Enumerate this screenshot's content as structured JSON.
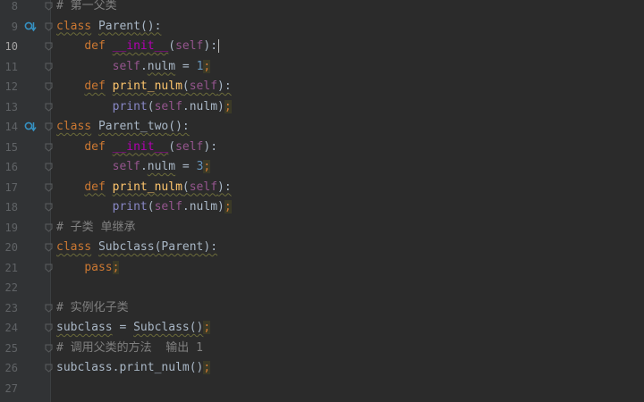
{
  "editor": {
    "lines": [
      {
        "n": "8",
        "segments": [
          {
            "t": "# 第一父类",
            "c": "cmt"
          }
        ]
      },
      {
        "n": "9",
        "marker": true,
        "segments": [
          {
            "t": "class",
            "c": "kw wavy"
          },
          {
            "t": " ",
            "c": ""
          },
          {
            "t": "Parent",
            "c": "wavy"
          },
          {
            "t": "():",
            "c": "wavy"
          }
        ]
      },
      {
        "n": "10",
        "current": true,
        "segments": [
          {
            "t": "    ",
            "c": ""
          },
          {
            "t": "def",
            "c": "kw"
          },
          {
            "t": " ",
            "c": ""
          },
          {
            "t": "__init__",
            "c": "magic wavy"
          },
          {
            "t": "(",
            "c": ""
          },
          {
            "t": "self",
            "c": "self"
          },
          {
            "t": "):",
            "c": ""
          }
        ]
      },
      {
        "n": "11",
        "segments": [
          {
            "t": "        ",
            "c": ""
          },
          {
            "t": "self",
            "c": "self"
          },
          {
            "t": ".",
            "c": ""
          },
          {
            "t": "nulm",
            "c": "wavy"
          },
          {
            "t": " = ",
            "c": ""
          },
          {
            "t": "1",
            "c": "num"
          },
          {
            "t": ";",
            "c": "semi"
          }
        ]
      },
      {
        "n": "12",
        "segments": [
          {
            "t": "    ",
            "c": ""
          },
          {
            "t": "def",
            "c": "kw wavy"
          },
          {
            "t": " ",
            "c": ""
          },
          {
            "t": "print_nulm",
            "c": "fn wavy"
          },
          {
            "t": "(",
            "c": "wavy"
          },
          {
            "t": "self",
            "c": "self wavy"
          },
          {
            "t": "):",
            "c": "wavy"
          }
        ]
      },
      {
        "n": "13",
        "segments": [
          {
            "t": "        ",
            "c": ""
          },
          {
            "t": "print",
            "c": "builtin"
          },
          {
            "t": "(",
            "c": ""
          },
          {
            "t": "self",
            "c": "self"
          },
          {
            "t": ".nulm)",
            "c": ""
          },
          {
            "t": ";",
            "c": "semi"
          }
        ]
      },
      {
        "n": "14",
        "marker": true,
        "segments": [
          {
            "t": "class",
            "c": "kw wavy"
          },
          {
            "t": " ",
            "c": ""
          },
          {
            "t": "Parent_two",
            "c": "wavy"
          },
          {
            "t": "():",
            "c": "wavy"
          }
        ]
      },
      {
        "n": "15",
        "segments": [
          {
            "t": "    ",
            "c": ""
          },
          {
            "t": "def",
            "c": "kw"
          },
          {
            "t": " ",
            "c": ""
          },
          {
            "t": "__init__",
            "c": "magic wavy"
          },
          {
            "t": "(",
            "c": ""
          },
          {
            "t": "self",
            "c": "self"
          },
          {
            "t": "):",
            "c": ""
          }
        ]
      },
      {
        "n": "16",
        "segments": [
          {
            "t": "        ",
            "c": ""
          },
          {
            "t": "self",
            "c": "self"
          },
          {
            "t": ".",
            "c": ""
          },
          {
            "t": "nulm",
            "c": "wavy"
          },
          {
            "t": " = ",
            "c": ""
          },
          {
            "t": "3",
            "c": "num"
          },
          {
            "t": ";",
            "c": "semi"
          }
        ]
      },
      {
        "n": "17",
        "segments": [
          {
            "t": "    ",
            "c": ""
          },
          {
            "t": "def",
            "c": "kw wavy"
          },
          {
            "t": " ",
            "c": ""
          },
          {
            "t": "print_nulm",
            "c": "fn wavy"
          },
          {
            "t": "(",
            "c": "wavy"
          },
          {
            "t": "self",
            "c": "self wavy"
          },
          {
            "t": "):",
            "c": "wavy"
          }
        ]
      },
      {
        "n": "18",
        "segments": [
          {
            "t": "        ",
            "c": ""
          },
          {
            "t": "print",
            "c": "builtin"
          },
          {
            "t": "(",
            "c": ""
          },
          {
            "t": "self",
            "c": "self"
          },
          {
            "t": ".nulm)",
            "c": ""
          },
          {
            "t": ";",
            "c": "semi"
          }
        ]
      },
      {
        "n": "19",
        "segments": [
          {
            "t": "# 子类 单继承",
            "c": "cmt"
          }
        ]
      },
      {
        "n": "20",
        "segments": [
          {
            "t": "class",
            "c": "kw wavy"
          },
          {
            "t": " ",
            "c": ""
          },
          {
            "t": "Subclass",
            "c": "wavy"
          },
          {
            "t": "(Parent):",
            "c": "wavy"
          }
        ]
      },
      {
        "n": "21",
        "segments": [
          {
            "t": "    ",
            "c": ""
          },
          {
            "t": "pass",
            "c": "kw"
          },
          {
            "t": ";",
            "c": "semi"
          }
        ]
      },
      {
        "n": "22",
        "segments": []
      },
      {
        "n": "23",
        "segments": [
          {
            "t": "# 实例化子类",
            "c": "cmt"
          }
        ]
      },
      {
        "n": "24",
        "segments": [
          {
            "t": "subclass",
            "c": "wavy"
          },
          {
            "t": " = ",
            "c": ""
          },
          {
            "t": "Subclass",
            "c": "wavy"
          },
          {
            "t": "()",
            "c": "wavy"
          },
          {
            "t": ";",
            "c": "semi"
          }
        ]
      },
      {
        "n": "25",
        "segments": [
          {
            "t": "# 调用父类的方法  输出 1",
            "c": "cmt"
          }
        ]
      },
      {
        "n": "26",
        "segments": [
          {
            "t": "subclass.print_nulm()",
            "c": ""
          },
          {
            "t": ";",
            "c": "semi"
          }
        ]
      },
      {
        "n": "27",
        "segments": []
      }
    ]
  },
  "colors": {
    "background": "#2b2b2b",
    "gutter": "#313335",
    "keyword": "#cc7832",
    "function": "#ffc66d",
    "self": "#94558d",
    "magic": "#b200b2",
    "number": "#6897bb",
    "comment": "#808080",
    "builtin": "#8888c6",
    "text": "#a9b7c6",
    "marker": "#3592c4"
  }
}
